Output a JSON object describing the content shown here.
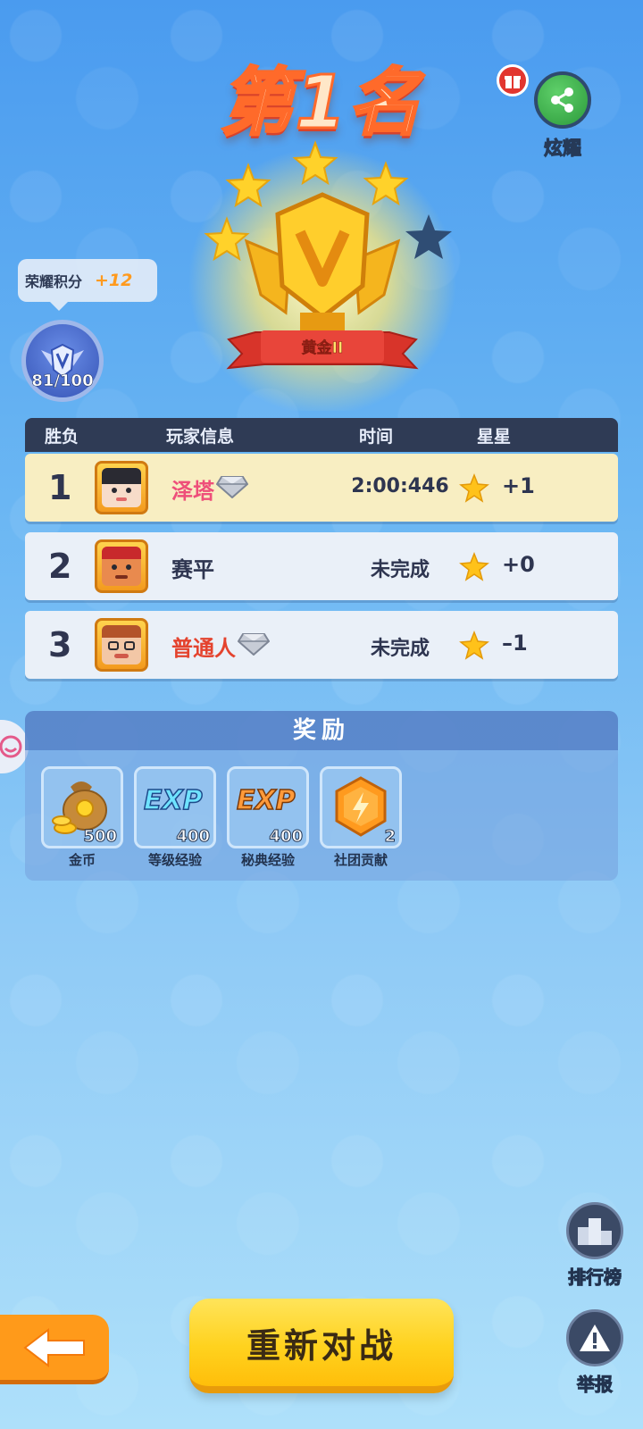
{
  "title": "第1名",
  "share": {
    "label": "炫耀"
  },
  "honor": {
    "label": "荣耀积分",
    "delta": "+12",
    "progress": "81/100"
  },
  "trophy": {
    "tier": "黄金II"
  },
  "table": {
    "headers": {
      "result": "胜负",
      "player": "玩家信息",
      "time": "时间",
      "stars": "星星"
    },
    "rows": [
      {
        "rank": "1",
        "name": "泽塔",
        "time": "2:00:446",
        "stars": "+1"
      },
      {
        "rank": "2",
        "name": "赛平",
        "time": "未完成",
        "stars": "+0"
      },
      {
        "rank": "3",
        "name": "普通人",
        "time": "未完成",
        "stars": "–1"
      }
    ]
  },
  "rewards": {
    "title": "奖励",
    "items": [
      {
        "label": "金币",
        "qty": "500"
      },
      {
        "label": "等级经验",
        "qty": "400",
        "badge": "EXP"
      },
      {
        "label": "秘典经验",
        "qty": "400",
        "badge": "EXP"
      },
      {
        "label": "社团贡献",
        "qty": "2"
      }
    ]
  },
  "side": {
    "leaderboard": "排行榜",
    "report": "举报"
  },
  "buttons": {
    "rematch": "重新对战"
  },
  "colors": {
    "gold": "#ffd21e",
    "name_pink": "#ee4f7a",
    "name_red": "#e4432e",
    "table_head": "#2f3b55"
  }
}
